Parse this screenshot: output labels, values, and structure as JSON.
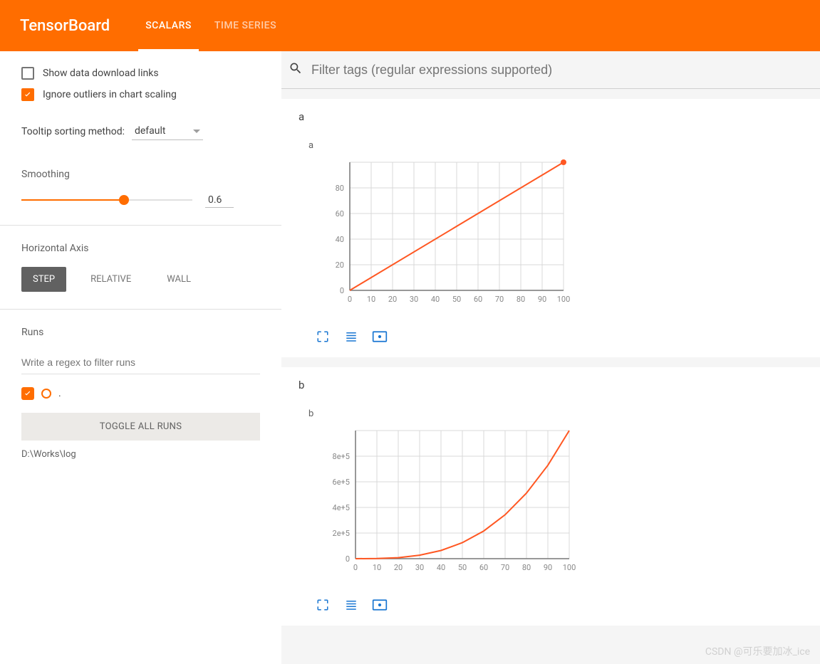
{
  "header": {
    "logo": "TensorBoard",
    "tabs": [
      "SCALARS",
      "TIME SERIES"
    ],
    "active_tab": 0
  },
  "sidebar": {
    "show_download_label": "Show data download links",
    "show_download_checked": false,
    "ignore_outliers_label": "Ignore outliers in chart scaling",
    "ignore_outliers_checked": true,
    "tooltip_sort_label": "Tooltip sorting method:",
    "tooltip_sort_value": "default",
    "smoothing_label": "Smoothing",
    "smoothing_value": "0.6",
    "horizontal_axis_label": "Horizontal Axis",
    "axis_options": [
      "STEP",
      "RELATIVE",
      "WALL"
    ],
    "axis_active": 0,
    "runs_label": "Runs",
    "runs_filter_placeholder": "Write a regex to filter runs",
    "run_name": ".",
    "toggle_all_label": "TOGGLE ALL RUNS",
    "log_path": "D:\\Works\\log"
  },
  "search": {
    "placeholder": "Filter tags (regular expressions supported)"
  },
  "cards": [
    {
      "title": "a",
      "chart_label": "a"
    },
    {
      "title": "b",
      "chart_label": "b"
    }
  ],
  "chart_data": [
    {
      "type": "line",
      "title": "a",
      "xlabel": "",
      "ylabel": "",
      "x_ticks": [
        0,
        10,
        20,
        30,
        40,
        50,
        60,
        70,
        80,
        90,
        100
      ],
      "y_ticks": [
        0,
        20,
        40,
        60,
        80
      ],
      "xlim": [
        0,
        100
      ],
      "ylim": [
        0,
        100
      ],
      "series": [
        {
          "name": ".",
          "color": "#ff5722",
          "x": [
            0,
            10,
            20,
            30,
            40,
            50,
            60,
            70,
            80,
            90,
            100
          ],
          "y": [
            0,
            10,
            20,
            30,
            40,
            50,
            60,
            70,
            80,
            90,
            100
          ]
        }
      ]
    },
    {
      "type": "line",
      "title": "b",
      "xlabel": "",
      "ylabel": "",
      "x_ticks": [
        0,
        10,
        20,
        30,
        40,
        50,
        60,
        70,
        80,
        90,
        100
      ],
      "y_tick_labels": [
        "0",
        "2e+5",
        "4e+5",
        "6e+5",
        "8e+5"
      ],
      "y_ticks": [
        0,
        200000,
        400000,
        600000,
        800000
      ],
      "xlim": [
        0,
        100
      ],
      "ylim": [
        0,
        1000000
      ],
      "series": [
        {
          "name": ".",
          "color": "#ff5722",
          "x": [
            0,
            10,
            20,
            30,
            40,
            50,
            60,
            70,
            80,
            90,
            100
          ],
          "y": [
            0,
            1000,
            8000,
            27000,
            64000,
            125000,
            216000,
            343000,
            512000,
            729000,
            1000000
          ]
        }
      ]
    }
  ],
  "watermark": "CSDN @可乐要加冰_ice"
}
